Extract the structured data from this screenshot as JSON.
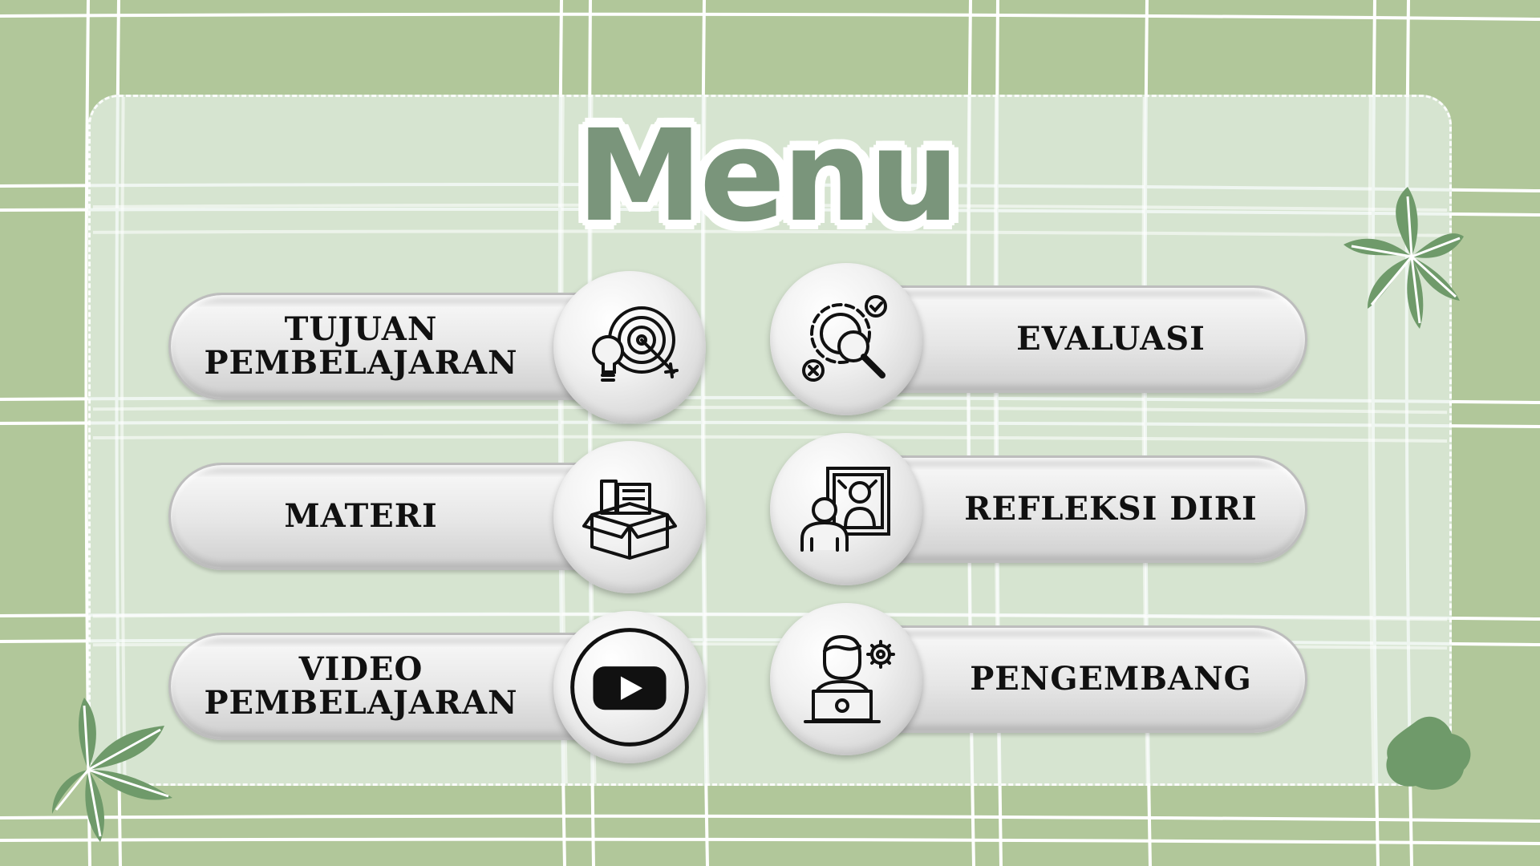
{
  "title": "Menu",
  "menu": {
    "tujuan": "TUJUAN\nPEMBELAJARAN",
    "materi": "MATERI",
    "video": "VIDEO\nPEMBELAJARAN",
    "evaluasi": "EVALUASI",
    "refleksi": "REFLEKSI DIRI",
    "pengembang": "PENGEMBANG"
  },
  "icons": {
    "tujuan": "target-lightbulb-icon",
    "materi": "book-box-icon",
    "video": "youtube-play-icon",
    "evaluasi": "gear-search-check-icon",
    "refleksi": "mirror-person-icon",
    "pengembang": "developer-laptop-icon"
  },
  "colors": {
    "background": "#b1c79a",
    "panel": "#e8f2ea",
    "title": "#7a957b",
    "leaf": "#6f9a6a"
  }
}
